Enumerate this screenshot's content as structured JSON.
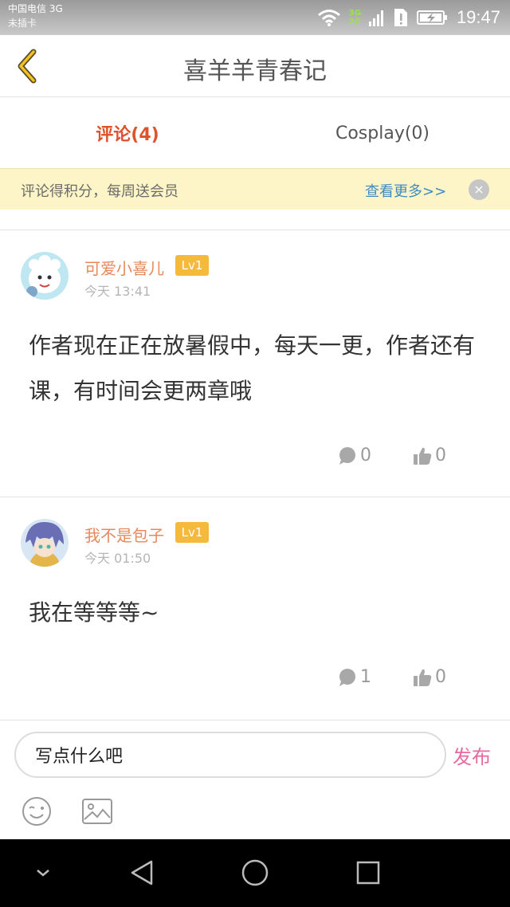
{
  "status_bar": {
    "carrier": "中国电信 3G",
    "sim_status": "未插卡",
    "network_badge_top": "3G",
    "network_badge_bottom": "2G",
    "time": "19:47",
    "icons": [
      "wifi-icon",
      "signal-icon",
      "sim-alert-icon",
      "battery-charging-icon"
    ]
  },
  "header": {
    "title": "喜羊羊青春记",
    "back_icon": "chevron-left-icon"
  },
  "tabs": [
    {
      "label": "评论(4)",
      "active": true
    },
    {
      "label": "Cosplay(0)",
      "active": false
    }
  ],
  "notice": {
    "text": "评论得积分，每周送会员",
    "link": "查看更多>>",
    "close": "×"
  },
  "comments": [
    {
      "user": "可爱小喜儿",
      "level": "Lv1",
      "time": "今天 13:41",
      "body": "作者现在正在放暑假中，每天一更，作者还有课，有时间会更两章哦",
      "reply_count": "0",
      "like_count": "0"
    },
    {
      "user": "我不是包子",
      "level": "Lv1",
      "time": "今天 01:50",
      "body": "我在等等等~",
      "reply_count": "1",
      "like_count": "0"
    }
  ],
  "input": {
    "value": "写点什么吧",
    "publish": "发布"
  },
  "colors": {
    "accent": "#e0522b",
    "username": "#e8885a",
    "level_badge": "#f5b93c",
    "link": "#3f8bc3",
    "publish": "#e46aa0",
    "notice_bg": "#fdf5c8"
  }
}
